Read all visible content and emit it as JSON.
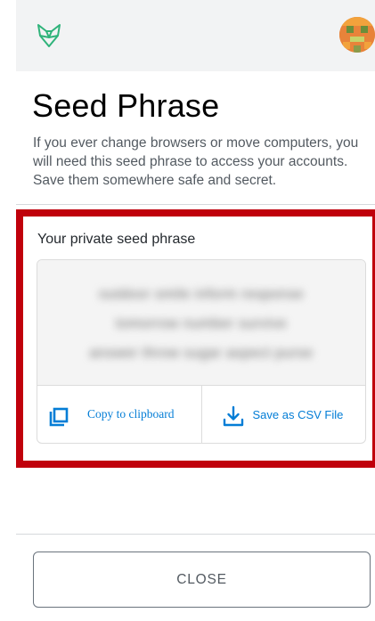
{
  "header": {
    "logo_icon": "fox-logo-icon",
    "avatar_icon": "account-avatar-icon"
  },
  "title": "Seed Phrase",
  "description": "If you ever change browsers or move computers, you will need this seed phrase to access your accounts. Save them somewhere safe and secret.",
  "seed_section": {
    "label": "Your private seed phrase",
    "blurred_lines": [
      "outdoor smile inform response",
      "tomorrow number survive",
      "answer throw sugar aspect purse"
    ],
    "copy": {
      "label": "Copy to clipboard",
      "icon": "copy-icon"
    },
    "save": {
      "label": "Save as CSV File",
      "icon": "download-icon"
    },
    "highlight_color": "#c0000b"
  },
  "footer": {
    "close_label": "CLOSE"
  },
  "colors": {
    "accent": "#037dd6",
    "logo": "#2fb37a"
  }
}
